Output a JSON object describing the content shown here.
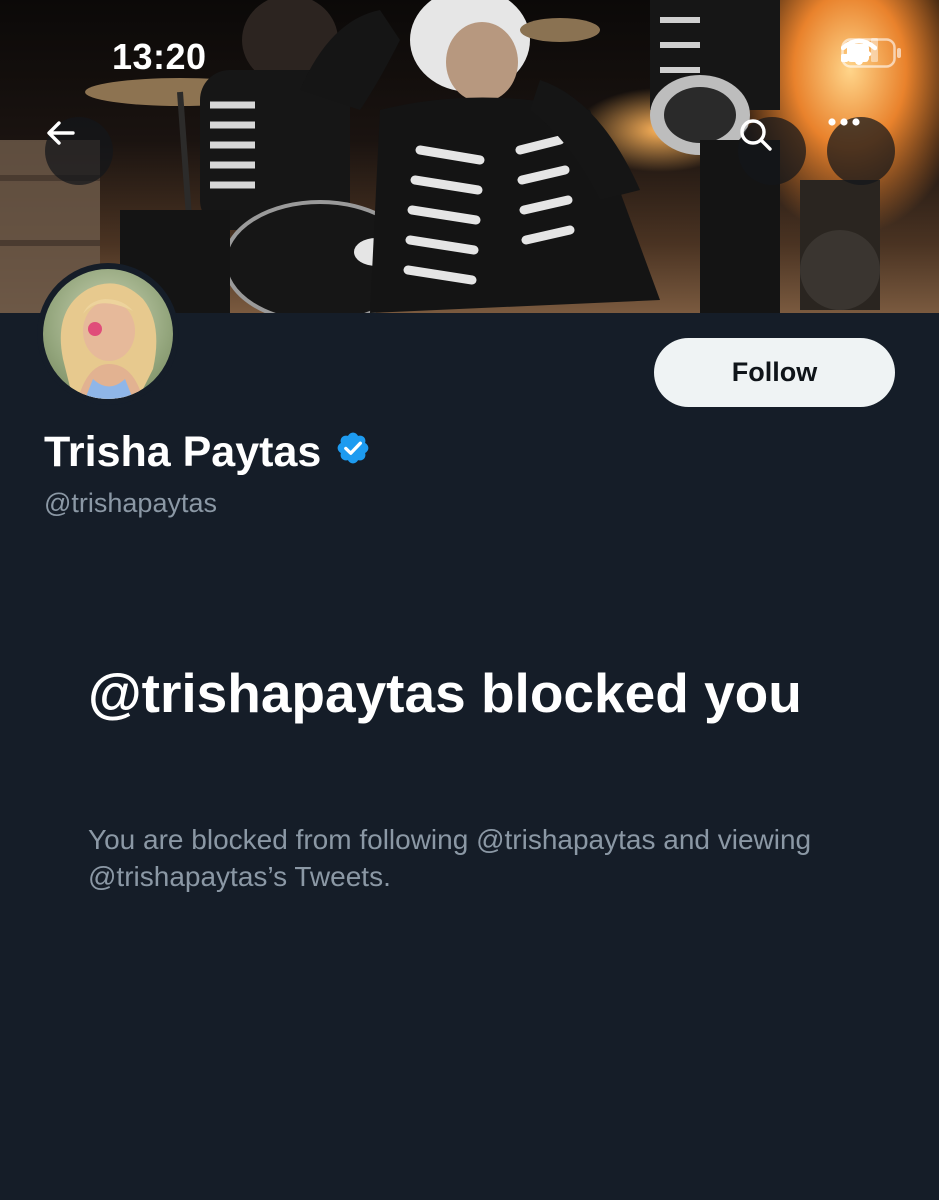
{
  "status_bar": {
    "time": "13:20"
  },
  "nav": {
    "back_icon": "arrow-left-icon",
    "search_icon": "search-icon",
    "more_icon": "more-horizontal-icon"
  },
  "profile": {
    "display_name": "Trisha Paytas",
    "handle": "@trishapaytas",
    "verified": true,
    "follow_label": "Follow"
  },
  "blocked_notice": {
    "title": "@trishapaytas blocked you",
    "description": "You are blocked from following @trishapaytas and viewing @trishapaytas’s Tweets."
  },
  "colors": {
    "background": "#151d28",
    "secondary_text": "#8b98a5",
    "verified_badge": "#1d9bf0",
    "follow_button_bg": "#eff3f4"
  }
}
